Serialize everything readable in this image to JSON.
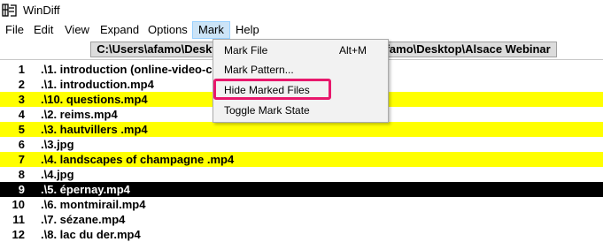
{
  "window": {
    "title": "WinDiff",
    "icon": "windiff-app-icon"
  },
  "menubar": {
    "items": [
      {
        "label": "File"
      },
      {
        "label": "Edit"
      },
      {
        "label": "View"
      },
      {
        "label": "Expand"
      },
      {
        "label": "Options"
      },
      {
        "label": "Mark"
      },
      {
        "label": "Help"
      }
    ],
    "active": "Mark"
  },
  "pathbar": {
    "path": "C:\\Users\\afamo\\Desktop\\Alsace Webinar    :    C:\\Users\\afamo\\Desktop\\Alsace Webinar"
  },
  "mark_menu": {
    "items": [
      {
        "label": "Mark File",
        "shortcut": "Alt+M"
      },
      {
        "label": "Mark Pattern..."
      },
      {
        "label": "Hide Marked Files"
      },
      {
        "label": "Toggle Mark State"
      }
    ],
    "highlighted": "Hide Marked Files",
    "highlight_color": "#e8186c"
  },
  "file_list": {
    "rows": [
      {
        "num": "1",
        "name": ".\\1. introduction (online-video-cutter.com).mp4",
        "style": "normal"
      },
      {
        "num": "2",
        "name": ".\\1. introduction.mp4",
        "style": "normal"
      },
      {
        "num": "3",
        "name": ".\\10. questions.mp4",
        "style": "yellow"
      },
      {
        "num": "4",
        "name": ".\\2. reims.mp4",
        "style": "normal"
      },
      {
        "num": "5",
        "name": ".\\3. hautvillers .mp4",
        "style": "yellow"
      },
      {
        "num": "6",
        "name": ".\\3.jpg",
        "style": "normal"
      },
      {
        "num": "7",
        "name": ".\\4. landscapes of champagne .mp4",
        "style": "yellow"
      },
      {
        "num": "8",
        "name": ".\\4.jpg",
        "style": "normal"
      },
      {
        "num": "9",
        "name": ".\\5. épernay.mp4",
        "style": "selected"
      },
      {
        "num": "10",
        "name": ".\\6. montmirail.mp4",
        "style": "normal"
      },
      {
        "num": "11",
        "name": ".\\7. sézane.mp4",
        "style": "normal"
      },
      {
        "num": "12",
        "name": ".\\8. lac du der.mp4",
        "style": "normal"
      }
    ],
    "colors": {
      "yellow": "#ffff00",
      "selected": "#000000"
    }
  }
}
